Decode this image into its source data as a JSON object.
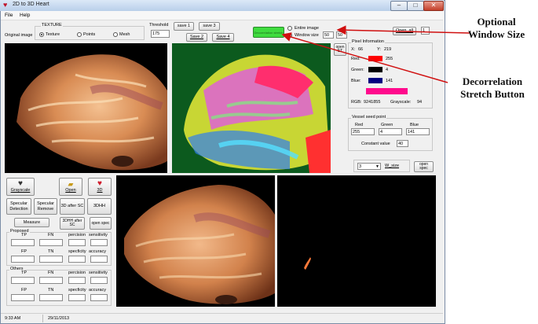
{
  "window": {
    "title": "2D to 3D Heart",
    "min_glyph": "–",
    "max_glyph": "□",
    "close_glyph": "✕"
  },
  "menu": {
    "file": "File",
    "help": "Help"
  },
  "texture": {
    "original_label": "Original image",
    "group_title": "TEXTURE",
    "options": [
      "Texture",
      "Points",
      "Mesh"
    ],
    "selected": "Texture"
  },
  "threshold": {
    "label": "Threshold",
    "value": "175"
  },
  "save_buttons": [
    "save 1",
    "save 3",
    "Save 2",
    "Save 4"
  ],
  "dsb_button": {
    "label": "Decorrelation stretch"
  },
  "window_options": {
    "entire": "Entire image",
    "size_label": "Window size",
    "size_w": "50",
    "size_h": "50",
    "selected": "Window size"
  },
  "open_all": {
    "label": "Open_all",
    "value": "1"
  },
  "open_st": "open ST",
  "pixel_info": {
    "title": "Pixel Information",
    "x_label": "X:",
    "x": "66",
    "y_label": "Y:",
    "y": "219",
    "red_label": "Red:",
    "red": "255",
    "green_label": "Green:",
    "green": "4",
    "blue_label": "Blue:",
    "blue": "141",
    "rgb_label": "RGB:",
    "rgb": "9241855",
    "gray_label": "Grayscale:",
    "gray": "94",
    "swatch_red": "#ff0000",
    "swatch_green": "#000000",
    "swatch_blue": "#000080",
    "mix_color": "#ff0a8d"
  },
  "vessel": {
    "title": "Vessel seed point",
    "red_label": "Red",
    "green_label": "Green",
    "blue_label": "Blue",
    "red": "255",
    "green": "4",
    "blue": "141",
    "constant_label": "Constant value",
    "constant": "40"
  },
  "wsize": {
    "value": "3",
    "label": "W_size",
    "open_spec": "open spec"
  },
  "left_buttons": {
    "grayscale": "Grayscale",
    "open": "Open",
    "three_d": "3D",
    "specular_detection": "Specular Detection",
    "specular_remove": "Specular Remove",
    "three_d_after_sc": "3D after SC",
    "three_dhh": "3DHH",
    "measure": "Measure",
    "three_dhh_after_sc": "3DHH after SC",
    "open_spec": "open spec"
  },
  "metrics": {
    "proposed_title": "Proposed",
    "others_title": "Others",
    "tp": "TP",
    "fn": "FN",
    "fp": "FP",
    "tn": "TN",
    "precision": "percision",
    "sensitivity": "sensitivity",
    "specificity": "specficity",
    "accuracy": "accuracy"
  },
  "status": {
    "time": "9:33 AM",
    "date": "29/11/2013"
  },
  "annotations": {
    "optional_window_size": [
      "Optional",
      "Window Size"
    ],
    "dsb": [
      "Decorrelation",
      "Stretch Button"
    ]
  }
}
